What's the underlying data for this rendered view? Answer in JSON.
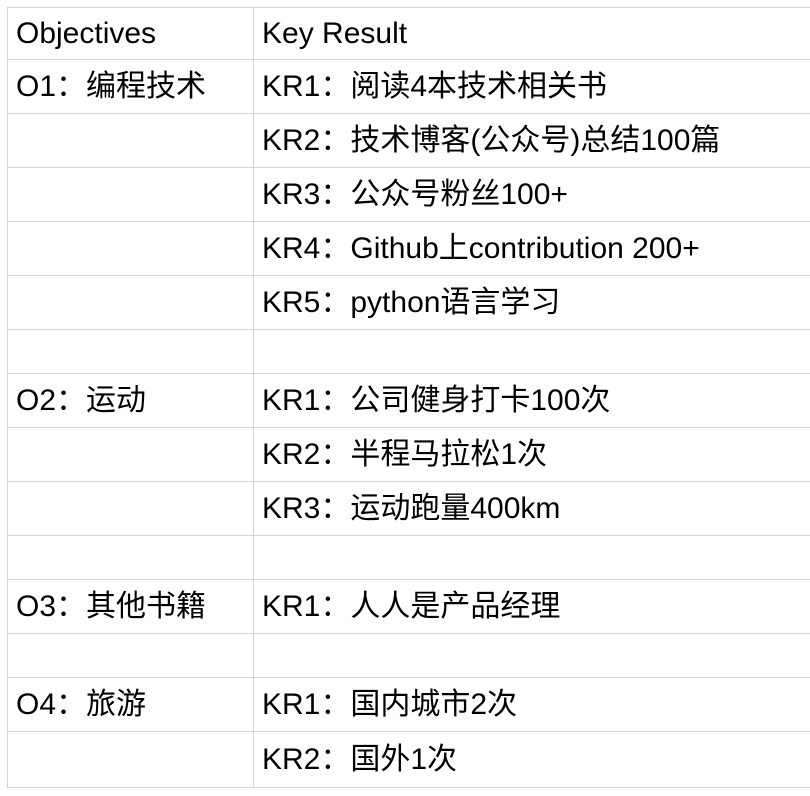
{
  "table": {
    "headers": {
      "objectives": "Objectives",
      "key_result": "Key Result"
    },
    "rows": [
      {
        "objective": "O1：编程技术",
        "key_result": "KR1：阅读4本技术相关书"
      },
      {
        "objective": "",
        "key_result": "KR2：技术博客(公众号)总结100篇"
      },
      {
        "objective": "",
        "key_result": "KR3：公众号粉丝100+"
      },
      {
        "objective": "",
        "key_result": "KR4：Github上contribution 200+"
      },
      {
        "objective": "",
        "key_result": "KR5：python语言学习"
      },
      {
        "objective": "",
        "key_result": ""
      },
      {
        "objective": "O2：运动",
        "key_result": "KR1：公司健身打卡100次"
      },
      {
        "objective": "",
        "key_result": "KR2：半程马拉松1次"
      },
      {
        "objective": "",
        "key_result": "KR3：运动跑量400km"
      },
      {
        "objective": "",
        "key_result": ""
      },
      {
        "objective": "O3：其他书籍",
        "key_result": "KR1：人人是产品经理"
      },
      {
        "objective": "",
        "key_result": ""
      },
      {
        "objective": "O4：旅游",
        "key_result": "KR1：国内城市2次"
      },
      {
        "objective": "",
        "key_result": "KR2：国外1次"
      }
    ]
  }
}
